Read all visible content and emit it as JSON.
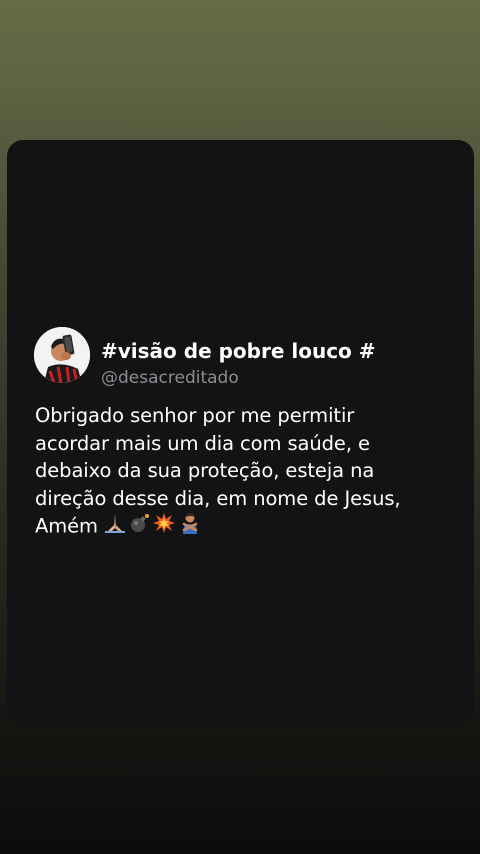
{
  "post": {
    "display_name": "#visão de pobre louco #",
    "handle": "@desacreditado",
    "body_lines": [
      "Obrigado senhor por me permitir",
      "acordar mais um dia com saúde, e",
      "debaixo da sua proteção, esteja na",
      "direção desse dia, em nome de Jesus,",
      "Amém"
    ],
    "emojis": [
      "praying-hands-icon",
      "bomb-icon",
      "collision-icon",
      "person-gesturing-no-icon"
    ]
  },
  "colors": {
    "card_background": "#121314",
    "handle_text": "#8b8d90",
    "text": "#ffffff"
  }
}
